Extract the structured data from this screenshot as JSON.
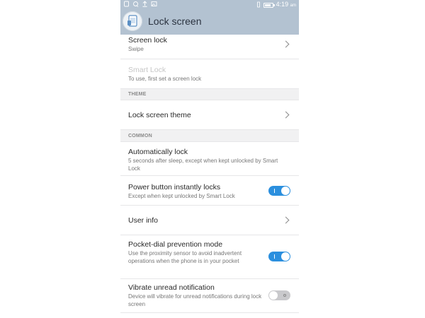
{
  "status_bar": {
    "time": "4:19",
    "ampm": "am",
    "icons": [
      "sim-icon",
      "sync-icon",
      "upload-icon",
      "image-icon",
      "vibrate-icon",
      "battery-icon"
    ]
  },
  "app_bar": {
    "title": "Lock screen",
    "icon": "lock-screen-app-icon"
  },
  "rows": {
    "screen_lock": {
      "title": "Screen lock",
      "subtitle": "Swipe"
    },
    "smart_lock": {
      "title": "Smart Lock",
      "subtitle": "To use, first set a screen lock"
    },
    "theme_section": "THEME",
    "lock_screen_theme": {
      "title": "Lock screen theme"
    },
    "common_section": "COMMON",
    "auto_lock": {
      "title": "Automatically lock",
      "subtitle": "5 seconds after sleep, except when kept unlocked by Smart Lock"
    },
    "power_button": {
      "title": "Power button instantly locks",
      "subtitle": "Except when kept unlocked by Smart Lock",
      "enabled": true
    },
    "user_info": {
      "title": "User info"
    },
    "pocket_dial": {
      "title": "Pocket-dial prevention mode",
      "subtitle": "Use the proximity sensor to avoid inadvertent operations when the phone is in your pocket",
      "enabled": true
    },
    "vibrate_unread": {
      "title": "Vibrate unread notification",
      "subtitle": "Device will vibrate for unread notifications during lock screen",
      "enabled": false
    }
  },
  "colors": {
    "app_bar": "#b3c2d1",
    "toggle_on": "#2b8fde",
    "toggle_off": "#c9c9cc"
  }
}
